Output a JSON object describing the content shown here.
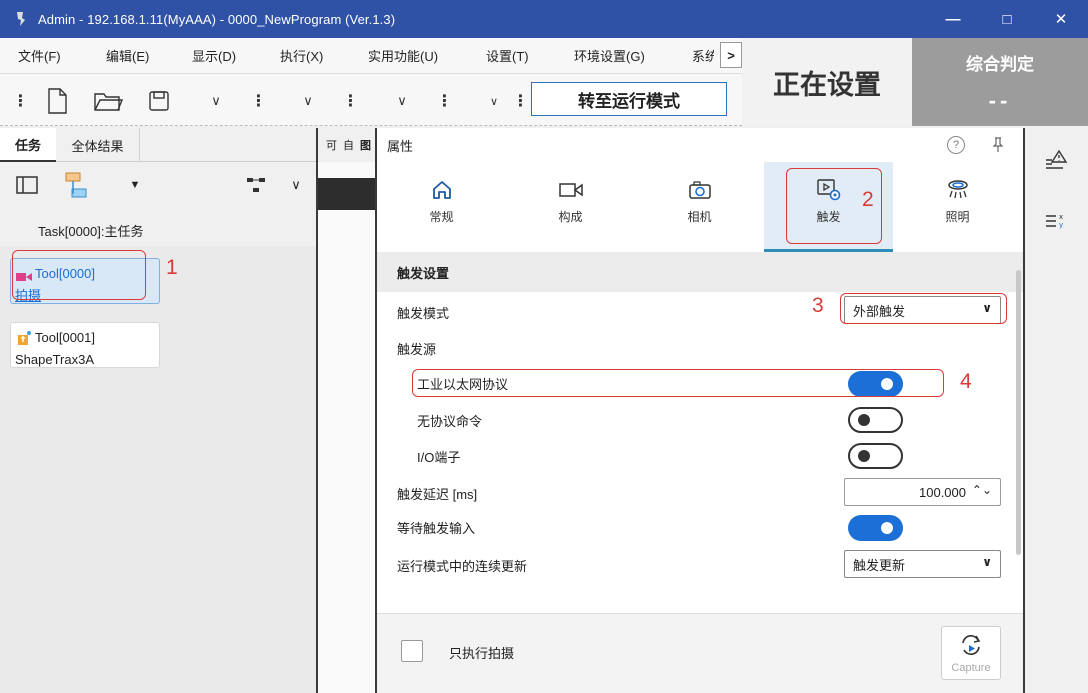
{
  "window": {
    "title": "Admin - 192.168.1.11(MyAAA) - 0000_NewProgram (Ver.1.3)",
    "min_glyph": "—",
    "max_glyph": "□",
    "close_glyph": "✕"
  },
  "menu": {
    "items": [
      "文件(F)",
      "编辑(E)",
      "显示(D)",
      "执行(X)",
      "实用功能(U)",
      "设置(T)",
      "环境设置(G)",
      "系统"
    ],
    "more_glyph": ">"
  },
  "toolbar": {
    "run_mode_button": "转至运行模式",
    "dropdown_glyph": "∨",
    "grip_glyph": "⋮"
  },
  "status": {
    "mode": "正在设置",
    "judgement_label": "综合判定",
    "judgement_value": "--"
  },
  "left_panel": {
    "tabs": [
      "任务",
      "全体结果"
    ],
    "active_tab": "任务",
    "task_label": "Task[0000]:主任务",
    "tools": [
      {
        "id": "Tool[0000]",
        "name": "拍摄",
        "selected": true,
        "icon": "camera-tool-icon"
      },
      {
        "id": "Tool[0001]",
        "name": "ShapeTrax3A",
        "selected": false,
        "icon": "shapetrax-tool-icon"
      }
    ]
  },
  "mid_strip": {
    "tabs": [
      "可",
      "自",
      "图"
    ]
  },
  "properties": {
    "header_title": "属性",
    "help_glyph": "?",
    "pin_glyph": "⚑",
    "tabs": [
      {
        "label": "常规",
        "icon": "home-icon"
      },
      {
        "label": "构成",
        "icon": "video-icon"
      },
      {
        "label": "相机",
        "icon": "camera-icon"
      },
      {
        "label": "触发",
        "icon": "trigger-settings-icon"
      },
      {
        "label": "照明",
        "icon": "light-icon"
      }
    ],
    "active_tab": "触发",
    "section_title": "触发设置",
    "trigger_mode_label": "触发模式",
    "trigger_mode_value": "外部触发",
    "trigger_source_label": "触发源",
    "sources": [
      {
        "label": "工业以太网协议",
        "on": true
      },
      {
        "label": "无协议命令",
        "on": false
      },
      {
        "label": "I/O端子",
        "on": false
      }
    ],
    "delay_label": "触发延迟 [ms]",
    "delay_value": "100.000",
    "wait_input_label": "等待触发输入",
    "wait_input_on": true,
    "continuous_label": "运行模式中的连续更新",
    "continuous_value": "触发更新",
    "footer_checkbox_label": "只执行拍摄",
    "capture_label": "Capture"
  },
  "annotations": {
    "numbers": [
      "1",
      "2",
      "3",
      "4"
    ],
    "color": "#d93a3a"
  },
  "colors": {
    "titlebar": "#2f52a6",
    "toggle_on": "#1b6fd6",
    "accent": "#2d8fb5"
  }
}
